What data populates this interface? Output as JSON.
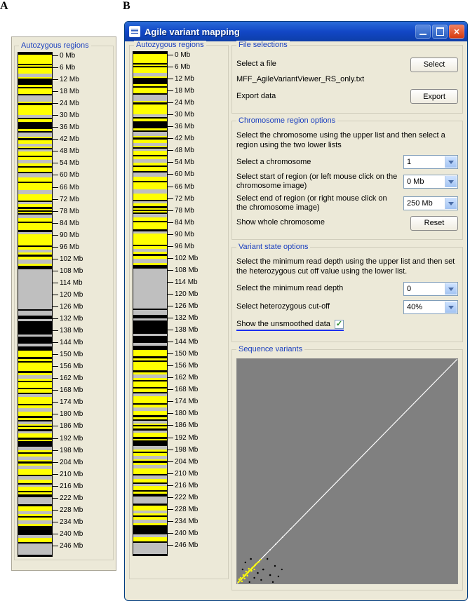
{
  "figure": {
    "label_a": "A",
    "label_b": "B"
  },
  "panelA": {
    "groupbox_title": "Autozygous regions",
    "ticks": [
      "0 Mb",
      "6 Mb",
      "12 Mb",
      "18 Mb",
      "24 Mb",
      "30 Mb",
      "36 Mb",
      "42 Mb",
      "48 Mb",
      "54 Mb",
      "60 Mb",
      "66 Mb",
      "72 Mb",
      "78 Mb",
      "84 Mb",
      "90 Mb",
      "96 Mb",
      "102 Mb",
      "108 Mb",
      "114 Mb",
      "120 Mb",
      "126 Mb",
      "132 Mb",
      "138 Mb",
      "144 Mb",
      "150 Mb",
      "156 Mb",
      "162 Mb",
      "168 Mb",
      "174 Mb",
      "180 Mb",
      "186 Mb",
      "192 Mb",
      "198 Mb",
      "204 Mb",
      "210 Mb",
      "216 Mb",
      "222 Mb",
      "228 Mb",
      "234 Mb",
      "240 Mb",
      "246 Mb"
    ]
  },
  "window": {
    "title": "Agile variant mapping",
    "left": {
      "groupbox_title": "Autozygous regions",
      "ticks": [
        "0 Mb",
        "6 Mb",
        "12 Mb",
        "18 Mb",
        "24 Mb",
        "30 Mb",
        "36 Mb",
        "42 Mb",
        "48 Mb",
        "54 Mb",
        "60 Mb",
        "66 Mb",
        "72 Mb",
        "78 Mb",
        "84 Mb",
        "90 Mb",
        "96 Mb",
        "102 Mb",
        "108 Mb",
        "114 Mb",
        "120 Mb",
        "126 Mb",
        "132 Mb",
        "138 Mb",
        "144 Mb",
        "150 Mb",
        "156 Mb",
        "162 Mb",
        "168 Mb",
        "174 Mb",
        "180 Mb",
        "186 Mb",
        "192 Mb",
        "198 Mb",
        "204 Mb",
        "210 Mb",
        "216 Mb",
        "222 Mb",
        "228 Mb",
        "234 Mb",
        "240 Mb",
        "246 Mb"
      ]
    },
    "file_selections": {
      "title": "File selections",
      "select_label": "Select a file",
      "select_btn": "Select",
      "filename": "MFF_AgileVariantViewer_RS_only.txt",
      "export_label": "Export data",
      "export_btn": "Export"
    },
    "chrom_region": {
      "title": "Chromosome region options",
      "instruction": "Select the chromosome using the upper list and then select a region using the two lower lists",
      "chrom_label": "Select a chromosome",
      "chrom_value": "1",
      "start_label": "Select start of region (or left mouse click on the chromosome image)",
      "start_value": "0 Mb",
      "end_label": "Select end of region (or right mouse click on the chromosome image)",
      "end_value": "250 Mb",
      "whole_label": "Show whole chromosome",
      "reset_btn": "Reset"
    },
    "variant_state": {
      "title": "Variant state options",
      "instruction": "Select the minimum read depth using the upper list and then set the heterozygous cut off value using the lower list.",
      "depth_label": "Select the minimum read depth",
      "depth_value": "0",
      "het_label": "Select heterozygous cut-off",
      "het_value": "40%",
      "unsmoothed_label": "Show the unsmoothed data",
      "unsmoothed_checked": true
    },
    "sequence_variants": {
      "title": "Sequence variants"
    }
  },
  "chart_data": {
    "type": "scatter",
    "title": "Sequence variants",
    "xlabel": "",
    "ylabel": "",
    "xlim": [
      0,
      250
    ],
    "ylim": [
      0,
      250
    ],
    "series": [
      {
        "name": "diagonal-guide",
        "color": "#ffffff",
        "points": "line y=x from 0 to 250"
      },
      {
        "name": "variants-yellow",
        "color": "#ffff00",
        "points": "dense cluster approximately 0–25 Mb along diagonal"
      },
      {
        "name": "variants-white",
        "color": "#ffffff",
        "points": "sparse near-diagonal 0–60 Mb"
      },
      {
        "name": "variants-black",
        "color": "#000000",
        "points": "scattered off-diagonal 0–50 Mb"
      }
    ]
  },
  "chromosome_bands": [
    {
      "c": "black",
      "h": 3
    },
    {
      "c": "yellow",
      "h": 12
    },
    {
      "c": "black",
      "h": 2
    },
    {
      "c": "yellow",
      "h": 2
    },
    {
      "c": "black",
      "h": 2
    },
    {
      "c": "yellow",
      "h": 8
    },
    {
      "c": "grey",
      "h": 5
    },
    {
      "c": "yellow",
      "h": 2
    },
    {
      "c": "black",
      "h": 8
    },
    {
      "c": "yellow",
      "h": 3
    },
    {
      "c": "black",
      "h": 2
    },
    {
      "c": "yellow",
      "h": 8
    },
    {
      "c": "black",
      "h": 2
    },
    {
      "c": "grey",
      "h": 8
    },
    {
      "c": "yellow",
      "h": 2
    },
    {
      "c": "black",
      "h": 3
    },
    {
      "c": "yellow",
      "h": 14
    },
    {
      "c": "grey",
      "h": 4
    },
    {
      "c": "black",
      "h": 2
    },
    {
      "c": "yellow",
      "h": 3
    },
    {
      "c": "black",
      "h": 10
    },
    {
      "c": "yellow",
      "h": 3
    },
    {
      "c": "black",
      "h": 2
    },
    {
      "c": "grey",
      "h": 6
    },
    {
      "c": "yellow",
      "h": 2
    },
    {
      "c": "black",
      "h": 2
    },
    {
      "c": "yellow",
      "h": 5
    },
    {
      "c": "grey",
      "h": 4
    },
    {
      "c": "yellow",
      "h": 2
    },
    {
      "c": "black",
      "h": 2
    },
    {
      "c": "grey",
      "h": 3
    },
    {
      "c": "yellow",
      "h": 6
    },
    {
      "c": "black",
      "h": 2
    },
    {
      "c": "yellow",
      "h": 3
    },
    {
      "c": "grey",
      "h": 5
    },
    {
      "c": "yellow",
      "h": 4
    },
    {
      "c": "black",
      "h": 2
    },
    {
      "c": "yellow",
      "h": 6
    },
    {
      "c": "black",
      "h": 2
    },
    {
      "c": "grey",
      "h": 6
    },
    {
      "c": "yellow",
      "h": 5
    },
    {
      "c": "black",
      "h": 2
    },
    {
      "c": "yellow",
      "h": 10
    },
    {
      "c": "grey",
      "h": 6
    },
    {
      "c": "yellow",
      "h": 8
    },
    {
      "c": "black",
      "h": 2
    },
    {
      "c": "grey",
      "h": 3
    },
    {
      "c": "yellow",
      "h": 4
    },
    {
      "c": "black",
      "h": 3
    },
    {
      "c": "yellow",
      "h": 2
    },
    {
      "c": "black",
      "h": 2
    },
    {
      "c": "yellow",
      "h": 2
    },
    {
      "c": "black",
      "h": 2
    },
    {
      "c": "grey",
      "h": 4
    },
    {
      "c": "yellow",
      "h": 5
    },
    {
      "c": "black",
      "h": 2
    },
    {
      "c": "yellow",
      "h": 10
    },
    {
      "c": "black",
      "h": 3
    },
    {
      "c": "grey",
      "h": 3
    },
    {
      "c": "yellow",
      "h": 15
    },
    {
      "c": "black",
      "h": 2
    },
    {
      "c": "yellow",
      "h": 4
    },
    {
      "c": "grey",
      "h": 4
    },
    {
      "c": "yellow",
      "h": 3
    },
    {
      "c": "black",
      "h": 2
    },
    {
      "c": "yellow",
      "h": 4
    },
    {
      "c": "grey",
      "h": 6
    },
    {
      "c": "yellow",
      "h": 3
    },
    {
      "c": "black",
      "h": 5
    },
    {
      "c": "grey",
      "h": 55
    },
    {
      "c": "black",
      "h": 2
    },
    {
      "c": "grey",
      "h": 6
    },
    {
      "c": "black",
      "h": 5
    },
    {
      "c": "grey",
      "h": 3
    },
    {
      "c": "black",
      "h": 18
    },
    {
      "c": "grey",
      "h": 3
    },
    {
      "c": "black",
      "h": 10
    },
    {
      "c": "grey",
      "h": 4
    },
    {
      "c": "black",
      "h": 6
    },
    {
      "c": "yellow",
      "h": 8
    },
    {
      "c": "black",
      "h": 3
    },
    {
      "c": "yellow",
      "h": 3
    },
    {
      "c": "black",
      "h": 2
    },
    {
      "c": "yellow",
      "h": 12
    },
    {
      "c": "black",
      "h": 2
    },
    {
      "c": "yellow",
      "h": 3
    },
    {
      "c": "grey",
      "h": 5
    },
    {
      "c": "yellow",
      "h": 3
    },
    {
      "c": "black",
      "h": 2
    },
    {
      "c": "yellow",
      "h": 8
    },
    {
      "c": "black",
      "h": 2
    },
    {
      "c": "yellow",
      "h": 4
    },
    {
      "c": "black",
      "h": 2
    },
    {
      "c": "grey",
      "h": 4
    },
    {
      "c": "yellow",
      "h": 10
    },
    {
      "c": "black",
      "h": 2
    },
    {
      "c": "yellow",
      "h": 4
    },
    {
      "c": "grey",
      "h": 4
    },
    {
      "c": "yellow",
      "h": 6
    },
    {
      "c": "black",
      "h": 3
    },
    {
      "c": "yellow",
      "h": 3
    },
    {
      "c": "black",
      "h": 2
    },
    {
      "c": "grey",
      "h": 4
    },
    {
      "c": "yellow",
      "h": 2
    },
    {
      "c": "black",
      "h": 2
    },
    {
      "c": "yellow",
      "h": 3
    },
    {
      "c": "black",
      "h": 2
    },
    {
      "c": "grey",
      "h": 3
    },
    {
      "c": "yellow",
      "h": 6
    },
    {
      "c": "black",
      "h": 3
    },
    {
      "c": "yellow",
      "h": 2
    },
    {
      "c": "black",
      "h": 8
    },
    {
      "c": "grey",
      "h": 4
    },
    {
      "c": "yellow",
      "h": 3
    },
    {
      "c": "black",
      "h": 2
    },
    {
      "c": "yellow",
      "h": 4
    },
    {
      "c": "grey",
      "h": 5
    },
    {
      "c": "yellow",
      "h": 2
    },
    {
      "c": "black",
      "h": 3
    },
    {
      "c": "yellow",
      "h": 3
    },
    {
      "c": "grey",
      "h": 4
    },
    {
      "c": "yellow",
      "h": 8
    },
    {
      "c": "black",
      "h": 2
    },
    {
      "c": "grey",
      "h": 5
    },
    {
      "c": "yellow",
      "h": 5
    },
    {
      "c": "black",
      "h": 2
    },
    {
      "c": "grey",
      "h": 3
    },
    {
      "c": "yellow",
      "h": 5
    },
    {
      "c": "black",
      "h": 2
    },
    {
      "c": "yellow",
      "h": 3
    },
    {
      "c": "black",
      "h": 4
    },
    {
      "c": "grey",
      "h": 10
    },
    {
      "c": "black",
      "h": 3
    },
    {
      "c": "yellow",
      "h": 6
    },
    {
      "c": "grey",
      "h": 4
    },
    {
      "c": "yellow",
      "h": 3
    },
    {
      "c": "black",
      "h": 2
    },
    {
      "c": "yellow",
      "h": 4
    },
    {
      "c": "grey",
      "h": 5
    },
    {
      "c": "yellow",
      "h": 3
    },
    {
      "c": "black",
      "h": 12
    },
    {
      "c": "grey",
      "h": 4
    },
    {
      "c": "yellow",
      "h": 6
    },
    {
      "c": "black",
      "h": 2
    },
    {
      "c": "grey",
      "h": 15
    },
    {
      "c": "black",
      "h": 2
    }
  ]
}
